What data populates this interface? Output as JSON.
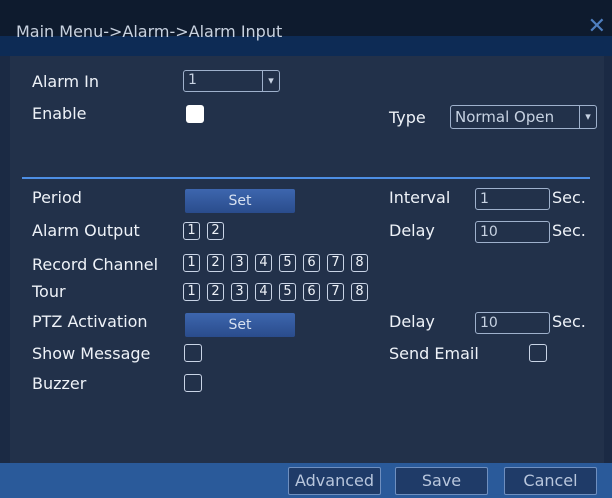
{
  "title": "Main Menu->Alarm->Alarm Input",
  "labels": {
    "alarm_in": "Alarm In",
    "enable": "Enable",
    "type": "Type",
    "period": "Period",
    "interval": "Interval",
    "alarm_output": "Alarm Output",
    "delay1": "Delay",
    "record_channel": "Record Channel",
    "tour": "Tour",
    "ptz_activation": "PTZ Activation",
    "delay2": "Delay",
    "show_message": "Show Message",
    "send_email": "Send Email",
    "buzzer": "Buzzer",
    "sec1": "Sec.",
    "sec2": "Sec.",
    "sec3": "Sec."
  },
  "values": {
    "alarm_in": "1",
    "type": "Normal Open",
    "interval": "1",
    "delay1": "10",
    "delay2": "10"
  },
  "buttons": {
    "period_set": "Set",
    "ptz_set": "Set",
    "advanced": "Advanced",
    "save": "Save",
    "cancel": "Cancel"
  },
  "alarm_output_channels": [
    "1",
    "2"
  ],
  "record_channels": [
    "1",
    "2",
    "3",
    "4",
    "5",
    "6",
    "7",
    "8"
  ],
  "tour_channels": [
    "1",
    "2",
    "3",
    "4",
    "5",
    "6",
    "7",
    "8"
  ],
  "icons": {
    "close": "close-icon",
    "dropdown": "chevron-down-icon"
  }
}
